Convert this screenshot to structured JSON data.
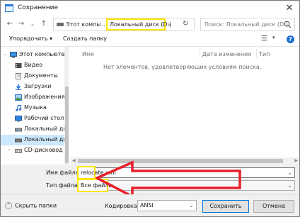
{
  "window": {
    "title": "Сохранение"
  },
  "address": {
    "path_part1": "Этот компь...",
    "path_part2": "Локальный диск (D:)",
    "search_placeholder": "Поиск: Локальный диск (D:)"
  },
  "toolbar": {
    "organize": "Упорядочить ▾",
    "new_folder": "Создать папку"
  },
  "sidebar": {
    "items": [
      {
        "label": "Этот компьютер",
        "icon": "computer-icon"
      },
      {
        "label": "Видео",
        "icon": "video-folder-icon"
      },
      {
        "label": "Документы",
        "icon": "documents-folder-icon"
      },
      {
        "label": "Загрузки",
        "icon": "downloads-folder-icon"
      },
      {
        "label": "Изображения",
        "icon": "pictures-folder-icon"
      },
      {
        "label": "Музыка",
        "icon": "music-folder-icon"
      },
      {
        "label": "Рабочий стол",
        "icon": "desktop-folder-icon"
      },
      {
        "label": "Локальный диск",
        "icon": "drive-icon"
      },
      {
        "label": "Локальный диск",
        "icon": "drive-icon"
      },
      {
        "label": "CD-дисковод (E",
        "icon": "cd-drive-icon"
      }
    ]
  },
  "filelist": {
    "columns": [
      "Имя",
      "Дата изменения",
      "Тип"
    ],
    "empty_message": "Нет элементов, удовлетворяющих условиям поиска."
  },
  "form": {
    "filename_label": "Имя файла:",
    "filename_value": "relocate.xml",
    "filetype_label": "Тип файла:",
    "filetype_value": "Все файлы"
  },
  "footer": {
    "hide_folders": "Скрыть папки",
    "encoding_label": "Кодировка:",
    "encoding_value": "ANSI",
    "save_button": "Сохранить",
    "cancel_button": "Отмена"
  },
  "colors": {
    "highlight": "#ffe600",
    "arrow": "#e8202a",
    "selection": "#cce8ff"
  }
}
